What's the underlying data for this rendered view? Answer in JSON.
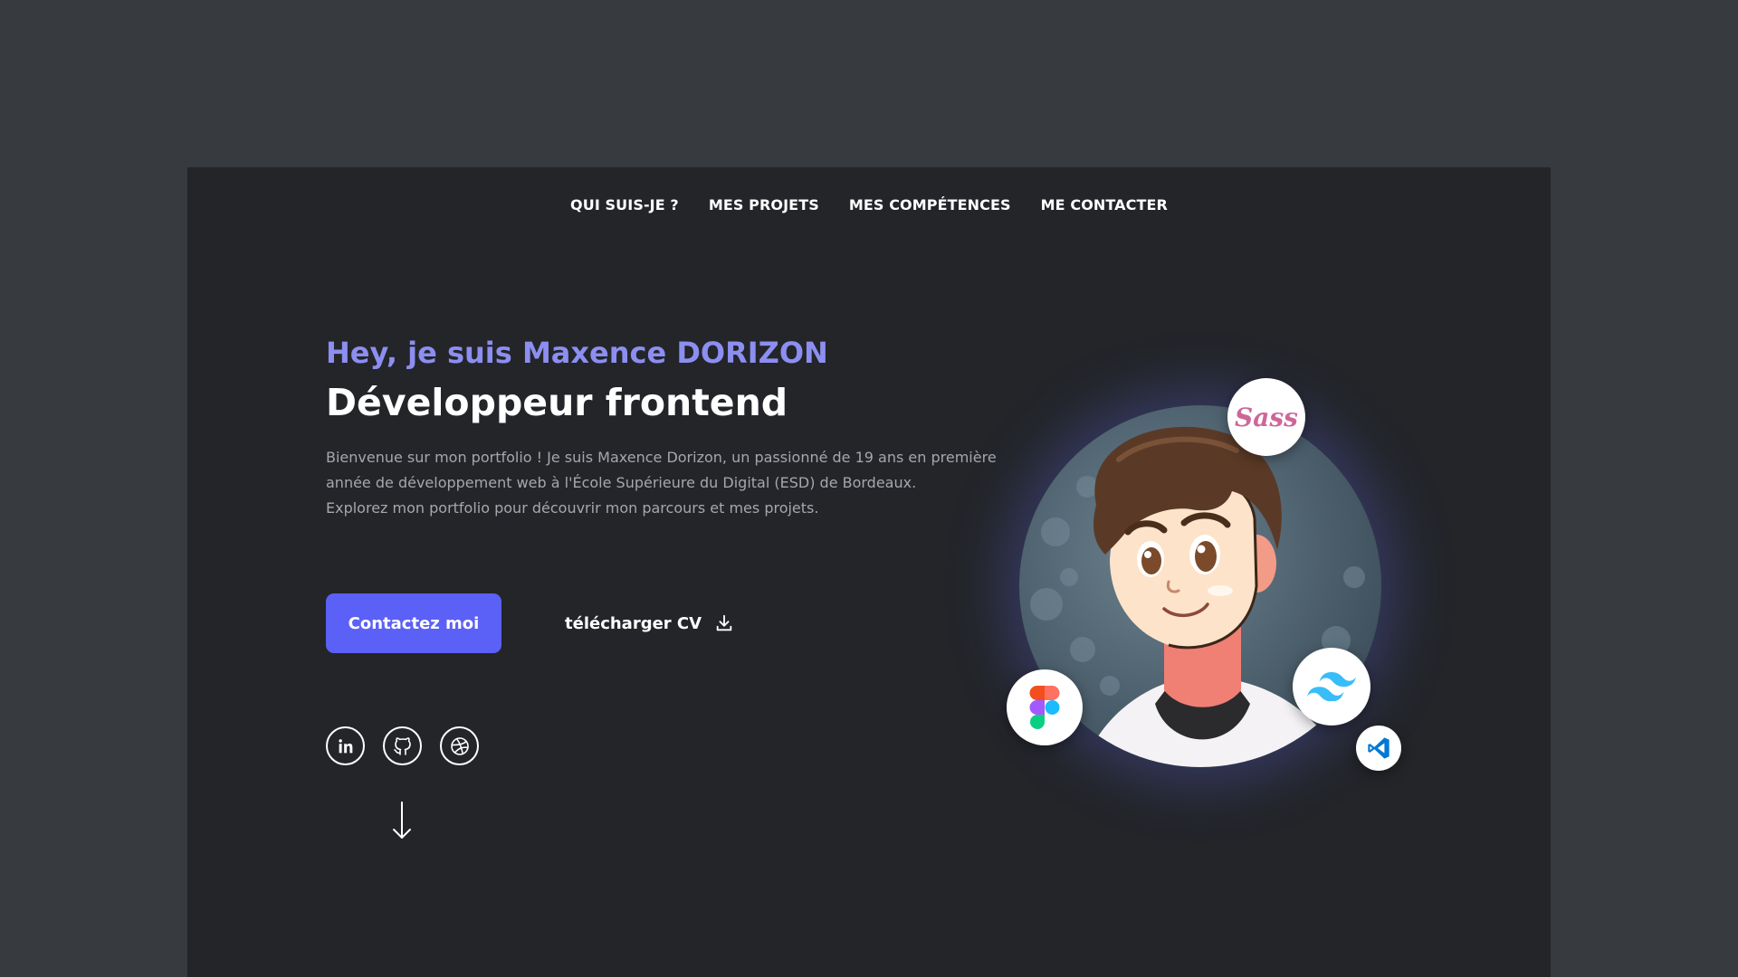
{
  "nav": {
    "items": [
      {
        "label": "QUI SUIS-JE ?"
      },
      {
        "label": "MES PROJETS"
      },
      {
        "label": "MES COMPÉTENCES"
      },
      {
        "label": "ME CONTACTER"
      }
    ]
  },
  "hero": {
    "greeting": "Hey, je suis Maxence DORIZON",
    "role": "Développeur frontend",
    "intro_line1": "Bienvenue sur mon portfolio ! Je suis Maxence Dorizon, un passionné de 19 ans en première année de développement web à l'École Supérieure du Digital (ESD) de Bordeaux.",
    "intro_line2": "Explorez mon portfolio pour découvrir mon parcours et mes projets."
  },
  "actions": {
    "contact_label": "Contactez moi",
    "cv_label": "télécharger CV"
  },
  "socials": [
    {
      "icon": "linkedin-icon"
    },
    {
      "icon": "github-icon"
    },
    {
      "icon": "dribbble-icon"
    }
  ],
  "badges": {
    "sass_text": "Sass"
  },
  "colors": {
    "background": "#373a3e",
    "page": "#232529",
    "accent": "#5b60f6",
    "greeting": "#8c8ef0",
    "text_muted": "#a4a7ad"
  }
}
